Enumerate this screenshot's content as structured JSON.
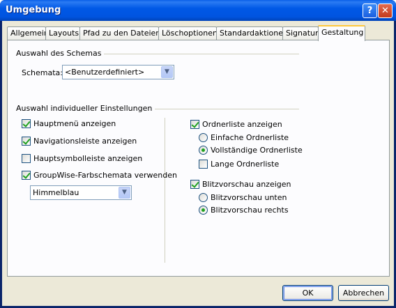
{
  "window": {
    "title": "Umgebung",
    "help_label": "?",
    "close_label": "✕"
  },
  "tabs": [
    {
      "label": "Allgemein"
    },
    {
      "label": "Layouts"
    },
    {
      "label": "Pfad zu den Dateien"
    },
    {
      "label": "Löschoptionen"
    },
    {
      "label": "Standardaktionen"
    },
    {
      "label": "Signatur"
    },
    {
      "label": "Gestaltung"
    }
  ],
  "schema": {
    "group_label": "Auswahl des Schemas",
    "field_label": "Schemata:",
    "value": "<Benutzerdefiniert>"
  },
  "individual": {
    "group_label": "Auswahl individueller Einstellungen",
    "left": {
      "hauptmenu": {
        "label": "Hauptmenü anzeigen",
        "checked": true
      },
      "navigation": {
        "label": "Navigationsleiste anzeigen",
        "checked": true
      },
      "hauptsymbol": {
        "label": "Hauptsymbolleiste anzeigen",
        "checked": false
      },
      "farbschema": {
        "label": "GroupWise-Farbschemata verwenden",
        "checked": true
      },
      "color_value": "Himmelblau"
    },
    "right": {
      "ordnerliste": {
        "label": "Ordnerliste anzeigen",
        "checked": true
      },
      "einfache": {
        "label": "Einfache Ordnerliste",
        "selected": false
      },
      "vollstaendige": {
        "label": "Vollständige Ordnerliste",
        "selected": true
      },
      "lange": {
        "label": "Lange Ordnerliste",
        "checked": false
      },
      "blitzvorschau": {
        "label": "Blitzvorschau anzeigen",
        "checked": true
      },
      "unten": {
        "label": "Blitzvorschau unten",
        "selected": false
      },
      "rechts": {
        "label": "Blitzvorschau rechts",
        "selected": true
      }
    }
  },
  "buttons": {
    "ok": "OK",
    "cancel": "Abbrechen"
  },
  "icons": {
    "dropdown": "chevron-down-icon",
    "help": "help-icon",
    "close": "close-icon"
  }
}
